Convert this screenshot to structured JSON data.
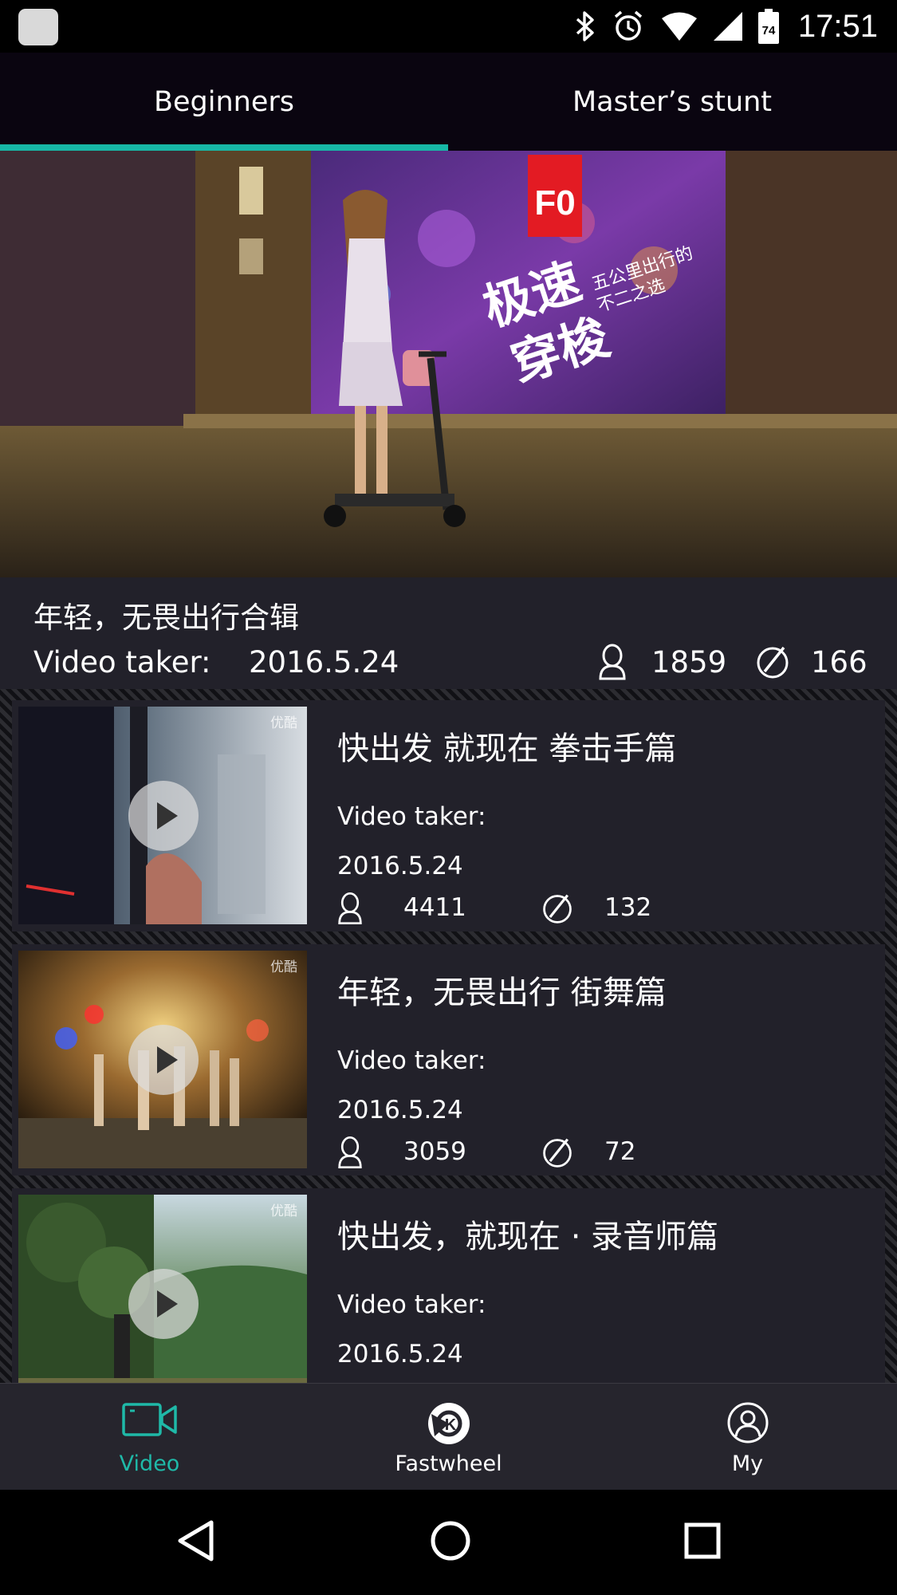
{
  "status_bar": {
    "time": "17:51",
    "battery_level": "74",
    "icons": [
      "app-notification-icon",
      "bluetooth-icon",
      "alarm-icon",
      "wifi-icon",
      "cell-signal-icon",
      "battery-icon"
    ]
  },
  "tabs": [
    {
      "label": "Beginners",
      "active": true
    },
    {
      "label": "Master’s stunt",
      "active": false
    }
  ],
  "featured": {
    "banner_badge": "F0",
    "banner_headline": "极速穿梭",
    "banner_slogan": "五公里出行的不二之选",
    "title": "年轻，无畏出行合辑",
    "taker_label": "Video taker:",
    "date": "2016.5.24",
    "views": "1859",
    "comments": "166"
  },
  "videos": [
    {
      "title": "快出发 就现在 拳击手篇",
      "taker_label": "Video taker:",
      "date": "2016.5.24",
      "views": "4411",
      "comments": "132",
      "watermark": "优酷"
    },
    {
      "title": "年轻，无畏出行 街舞篇",
      "taker_label": "Video taker:",
      "date": "2016.5.24",
      "views": "3059",
      "comments": "72",
      "watermark": "优酷"
    },
    {
      "title": "快出发，就现在 · 录音师篇",
      "taker_label": "Video taker:",
      "date": "2016.5.24",
      "watermark": "优酷"
    }
  ],
  "bottom_nav": [
    {
      "label": "Video",
      "icon": "video-camera-icon",
      "active": true
    },
    {
      "label": "Fastwheel",
      "icon": "fastwheel-logo-icon",
      "active": false
    },
    {
      "label": "My",
      "icon": "profile-icon",
      "active": false
    }
  ],
  "colors": {
    "accent": "#17b8a6",
    "card_bg": "#22212a",
    "tab_bar_bg": "#0a0510",
    "nav_bg": "#26252d"
  }
}
